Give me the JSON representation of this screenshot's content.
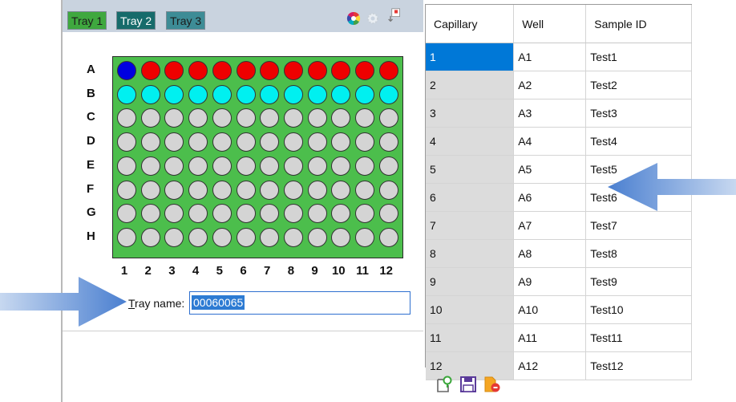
{
  "trays": {
    "tabs": [
      {
        "label": "Tray 1",
        "color": "#3fa83f"
      },
      {
        "label": "Tray 2",
        "color": "#166b6b"
      },
      {
        "label": "Tray 3",
        "color": "#3d8c96"
      }
    ]
  },
  "plate": {
    "rows": [
      "A",
      "B",
      "C",
      "D",
      "E",
      "F",
      "G",
      "H"
    ],
    "columns": [
      "1",
      "2",
      "3",
      "4",
      "5",
      "6",
      "7",
      "8",
      "9",
      "10",
      "11",
      "12"
    ],
    "background": "#4cbe4c",
    "well_colors": {
      "A1": "#0000e0",
      "A": "#ee0000",
      "B": "#00f0f0",
      "empty": "#d4d4d4"
    }
  },
  "tray_name": {
    "label_access": "T",
    "label_rest": "ray name:",
    "value": "00060065"
  },
  "table": {
    "headers": [
      "Capillary",
      "Well",
      "Sample ID"
    ],
    "rows": [
      {
        "capillary": "1",
        "well": "A1",
        "sample_id": "Test1"
      },
      {
        "capillary": "2",
        "well": "A2",
        "sample_id": "Test2"
      },
      {
        "capillary": "3",
        "well": "A3",
        "sample_id": "Test3"
      },
      {
        "capillary": "4",
        "well": "A4",
        "sample_id": "Test4"
      },
      {
        "capillary": "5",
        "well": "A5",
        "sample_id": "Test5"
      },
      {
        "capillary": "6",
        "well": "A6",
        "sample_id": "Test6"
      },
      {
        "capillary": "7",
        "well": "A7",
        "sample_id": "Test7"
      },
      {
        "capillary": "8",
        "well": "A8",
        "sample_id": "Test8"
      },
      {
        "capillary": "9",
        "well": "A9",
        "sample_id": "Test9"
      },
      {
        "capillary": "10",
        "well": "A10",
        "sample_id": "Test10"
      },
      {
        "capillary": "11",
        "well": "A11",
        "sample_id": "Test11"
      },
      {
        "capillary": "12",
        "well": "A12",
        "sample_id": "Test12"
      }
    ]
  },
  "icons": [
    "color-wheel-icon",
    "gear-icon",
    "settings-export-icon",
    "add-location-icon",
    "save-icon",
    "remove-file-icon"
  ],
  "colors": {
    "selection": "#0078d7",
    "arrow": "#5b8fd6",
    "capillary_cell": "#dcdcdc"
  }
}
